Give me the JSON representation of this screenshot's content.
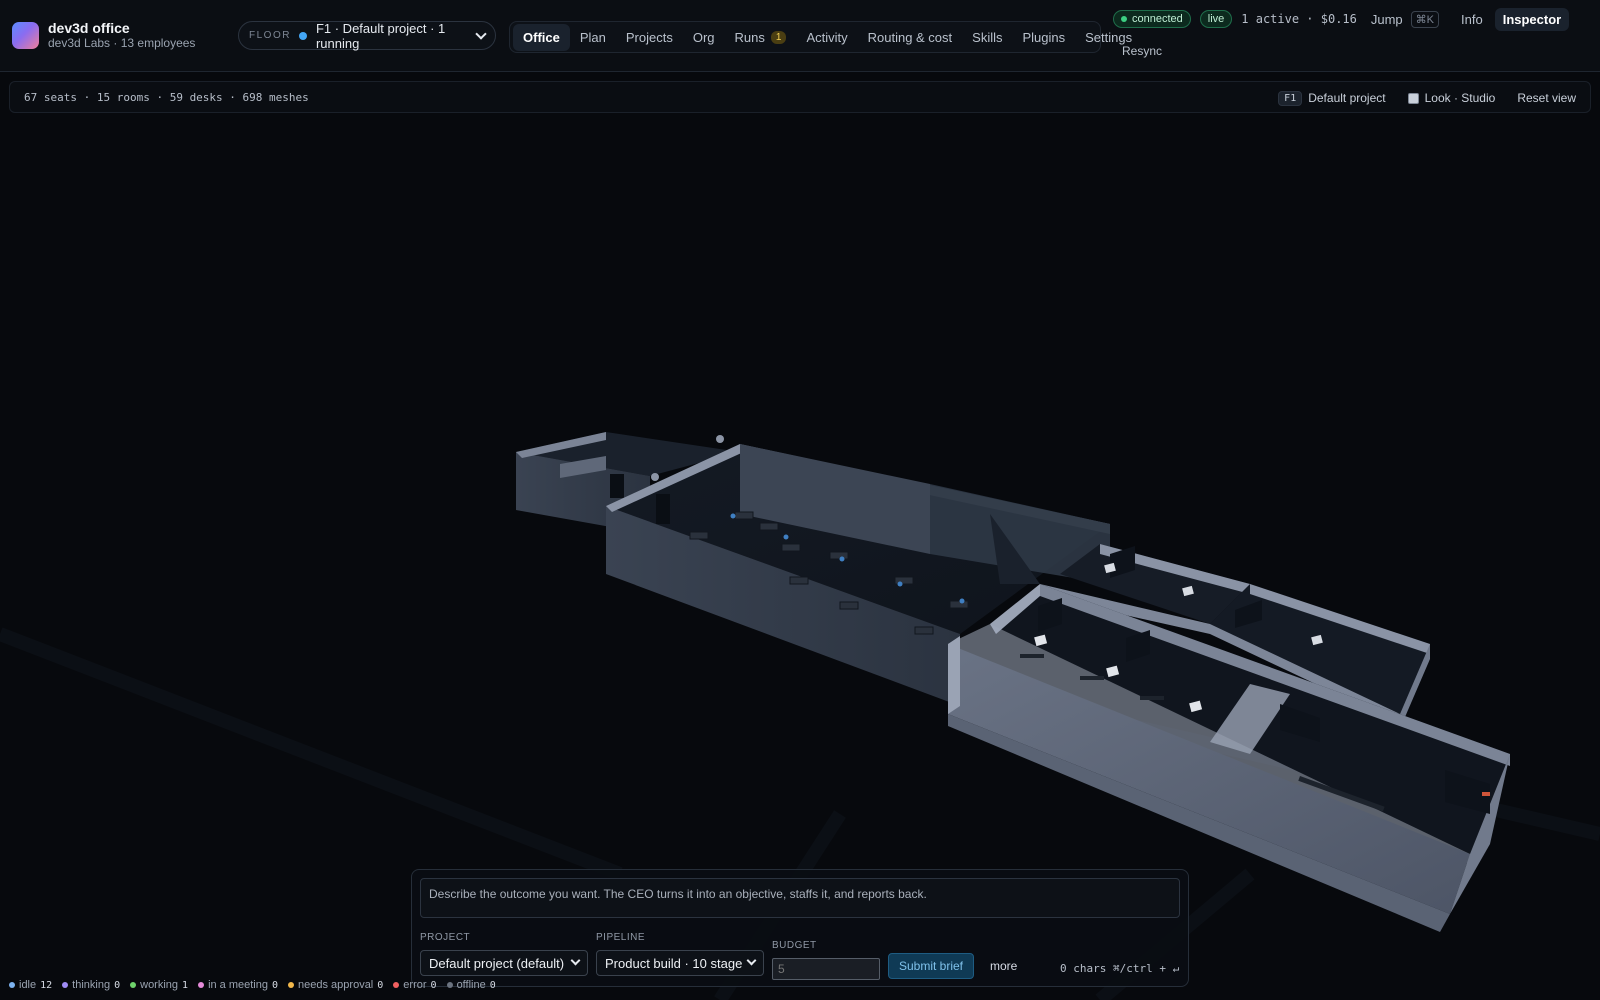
{
  "app": {
    "title": "dev3d office",
    "subtitle": "dev3d Labs · 13 employees"
  },
  "floor": {
    "label": "FLOOR",
    "value": "F1 · Default project · 1 running",
    "dot_color": "#43a6f5"
  },
  "nav": {
    "items": [
      {
        "label": "Office",
        "active": true
      },
      {
        "label": "Plan"
      },
      {
        "label": "Projects"
      },
      {
        "label": "Org"
      },
      {
        "label": "Runs",
        "count": "1"
      },
      {
        "label": "Activity"
      },
      {
        "label": "Routing & cost"
      },
      {
        "label": "Skills"
      },
      {
        "label": "Plugins"
      },
      {
        "label": "Settings"
      }
    ]
  },
  "status": {
    "connected": "connected",
    "live": "live",
    "summary": "1 active · $0.16",
    "jump": "Jump",
    "jump_kbd": "⌘K",
    "info": "Info",
    "inspector": "Inspector",
    "resync": "Resync"
  },
  "stats": {
    "text": "67 seats · 15 rooms · 59 desks · 698 meshes",
    "floor_tag": "F1",
    "project": "Default project",
    "look": "Look · Studio",
    "reset": "Reset view"
  },
  "composer": {
    "placeholder": "Describe the outcome you want. The CEO turns it into an objective, staffs it, and reports back.",
    "project_label": "PROJECT",
    "project_value": "Default project (default)",
    "pipeline_label": "PIPELINE",
    "pipeline_value": "Product build · 10 stage",
    "budget_label": "BUDGET",
    "budget_placeholder": "5",
    "submit": "Submit brief",
    "more": "more",
    "chars": "0 chars  ⌘/ctrl + ↵"
  },
  "legend": [
    {
      "label": "idle",
      "count": "12",
      "color": "#7db3f0"
    },
    {
      "label": "thinking",
      "count": "0",
      "color": "#a08cf5"
    },
    {
      "label": "working",
      "count": "1",
      "color": "#6ed36b"
    },
    {
      "label": "in a meeting",
      "count": "0",
      "color": "#e58bd9"
    },
    {
      "label": "needs approval",
      "count": "0",
      "color": "#f2b84b"
    },
    {
      "label": "error",
      "count": "0",
      "color": "#ef6060"
    },
    {
      "label": "offline",
      "count": "0",
      "color": "#6b7380"
    }
  ]
}
